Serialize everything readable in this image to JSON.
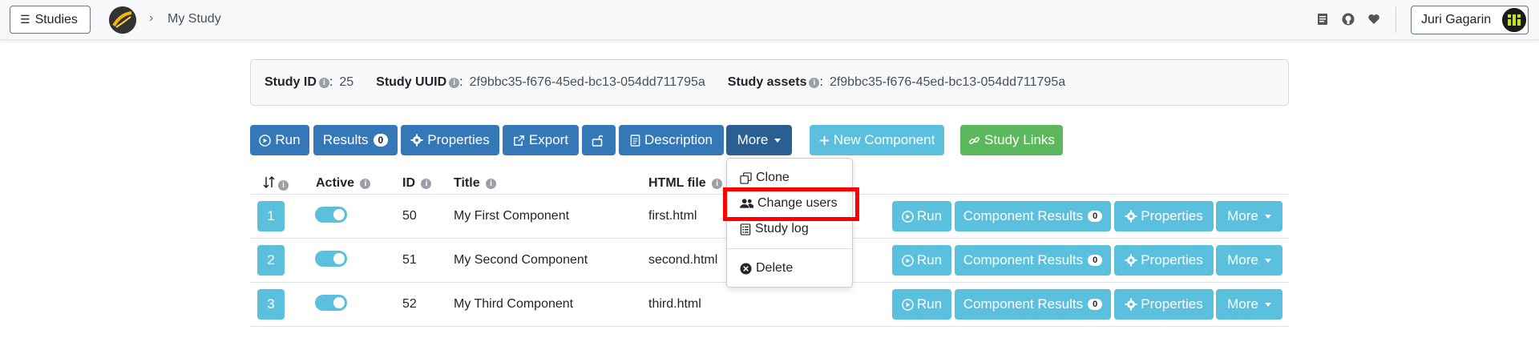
{
  "navbar": {
    "studies_label": "Studies",
    "breadcrumb": "My Study",
    "user_name": "Juri Gagarin",
    "icons": [
      "doc-icon",
      "github-icon",
      "heart-icon"
    ]
  },
  "info": {
    "study_id_label": "Study ID",
    "study_id": "25",
    "study_uuid_label": "Study UUID",
    "study_uuid": "2f9bbc35-f676-45ed-bc13-054dd711795a",
    "study_assets_label": "Study assets",
    "study_assets": "2f9bbc35-f676-45ed-bc13-054dd711795a"
  },
  "toolbar": {
    "run": "Run",
    "results": "Results",
    "results_count": "0",
    "properties": "Properties",
    "export": "Export",
    "description": "Description",
    "more": "More",
    "new_component": "New Component",
    "study_links": "Study Links"
  },
  "table": {
    "headers": {
      "active": "Active",
      "id": "ID",
      "title": "Title",
      "html_file": "HTML file"
    },
    "rows": [
      {
        "position": "1",
        "id": "50",
        "title": "My First Component",
        "html_file": "first.html",
        "results_count": "0"
      },
      {
        "position": "2",
        "id": "51",
        "title": "My Second Component",
        "html_file": "second.html",
        "results_count": "0"
      },
      {
        "position": "3",
        "id": "52",
        "title": "My Third Component",
        "html_file": "third.html",
        "results_count": "0"
      }
    ],
    "row_buttons": {
      "run": "Run",
      "component_results": "Component Results",
      "properties": "Properties",
      "more": "More"
    }
  },
  "dropdown": {
    "clone": "Clone",
    "change_users": "Change users",
    "study_log": "Study log",
    "delete": "Delete"
  },
  "colors": {
    "primary": "#3478b7",
    "info": "#5bc0de",
    "success": "#5cb85c",
    "highlight": "#ff0000"
  }
}
